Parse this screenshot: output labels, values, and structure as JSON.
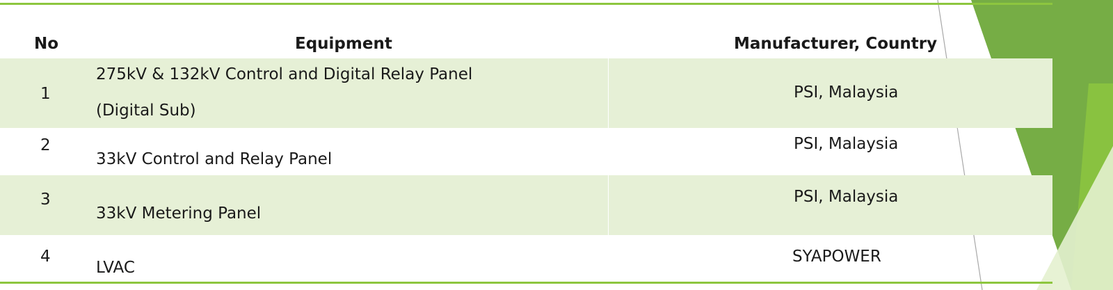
{
  "table": {
    "headers": {
      "no": "No",
      "equipment": "Equipment",
      "manufacturer": "Manufacturer, Country"
    },
    "rows": [
      {
        "no": "1",
        "equipment_line1": "275kV & 132kV Control and Digital Relay Panel",
        "equipment_line2": "(Digital Sub)",
        "manufacturer": "PSI, Malaysia"
      },
      {
        "no": "2",
        "equipment": "33kV Control and Relay Panel",
        "manufacturer": "PSI, Malaysia"
      },
      {
        "no": "3",
        "equipment": "33kV Metering Panel",
        "manufacturer": "PSI, Malaysia"
      },
      {
        "no": "4",
        "equipment": "LVAC",
        "manufacturer": "SYAPOWER"
      }
    ]
  },
  "colors": {
    "accent_rule": "#8dc63f",
    "row_shade": "#e6f0d6",
    "deco_dark": "#6aa341",
    "deco_mid": "#8dc63f",
    "deco_light": "#cfe6ad"
  }
}
